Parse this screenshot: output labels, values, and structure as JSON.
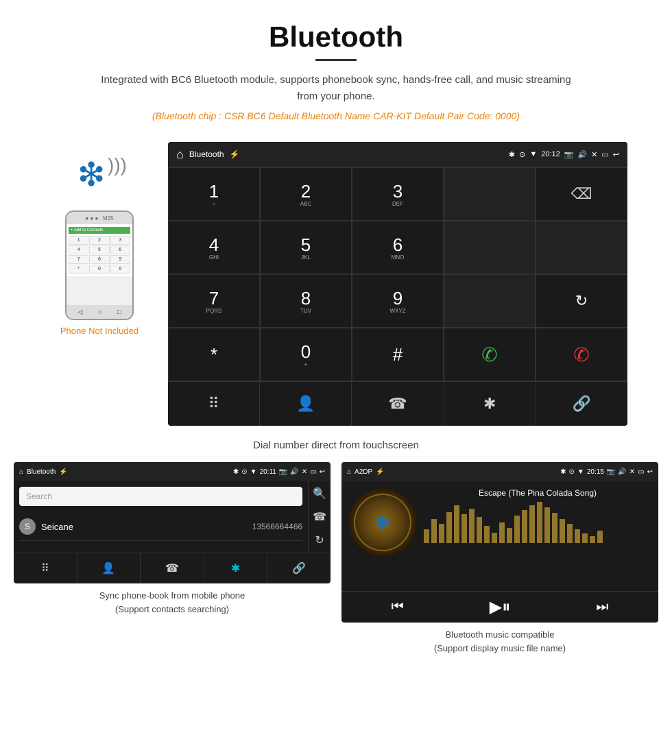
{
  "page": {
    "title": "Bluetooth",
    "subtitle": "Integrated with BC6 Bluetooth module, supports phonebook sync, hands-free call, and music streaming from your phone.",
    "spec_line": "(Bluetooth chip : CSR BC6    Default Bluetooth Name CAR-KIT    Default Pair Code: 0000)",
    "dial_caption": "Dial number direct from touchscreen",
    "phonebook_caption": "Sync phone-book from mobile phone\n(Support contacts searching)",
    "music_caption": "Bluetooth music compatible\n(Support display music file name)",
    "phone_not_included": "Phone Not Included"
  },
  "statusbar": {
    "app_name": "Bluetooth",
    "time": "20:12"
  },
  "dialpad": {
    "keys": [
      {
        "label": "1",
        "sub": ""
      },
      {
        "label": "2",
        "sub": "ABC"
      },
      {
        "label": "3",
        "sub": "DEF"
      },
      {
        "label": "",
        "sub": ""
      },
      {
        "label": "⌫",
        "sub": ""
      },
      {
        "label": "4",
        "sub": "GHI"
      },
      {
        "label": "5",
        "sub": "JKL"
      },
      {
        "label": "6",
        "sub": "MNO"
      },
      {
        "label": "",
        "sub": ""
      },
      {
        "label": "",
        "sub": ""
      },
      {
        "label": "7",
        "sub": "PQRS"
      },
      {
        "label": "8",
        "sub": "TUV"
      },
      {
        "label": "9",
        "sub": "WXYZ"
      },
      {
        "label": "",
        "sub": ""
      },
      {
        "label": "↻",
        "sub": ""
      },
      {
        "label": "*",
        "sub": ""
      },
      {
        "label": "0",
        "sub": "+"
      },
      {
        "label": "#",
        "sub": ""
      },
      {
        "label": "✆",
        "sub": ""
      },
      {
        "label": "✆",
        "sub": "end"
      }
    ]
  },
  "small_statusbar1": {
    "app_name": "Bluetooth",
    "time": "20:11"
  },
  "small_statusbar2": {
    "app_name": "A2DP",
    "time": "20:15"
  },
  "contacts": [
    {
      "initial": "S",
      "name": "Seicane",
      "number": "13566664466"
    }
  ],
  "music": {
    "song_title": "Escape (The Pina Colada Song)"
  }
}
